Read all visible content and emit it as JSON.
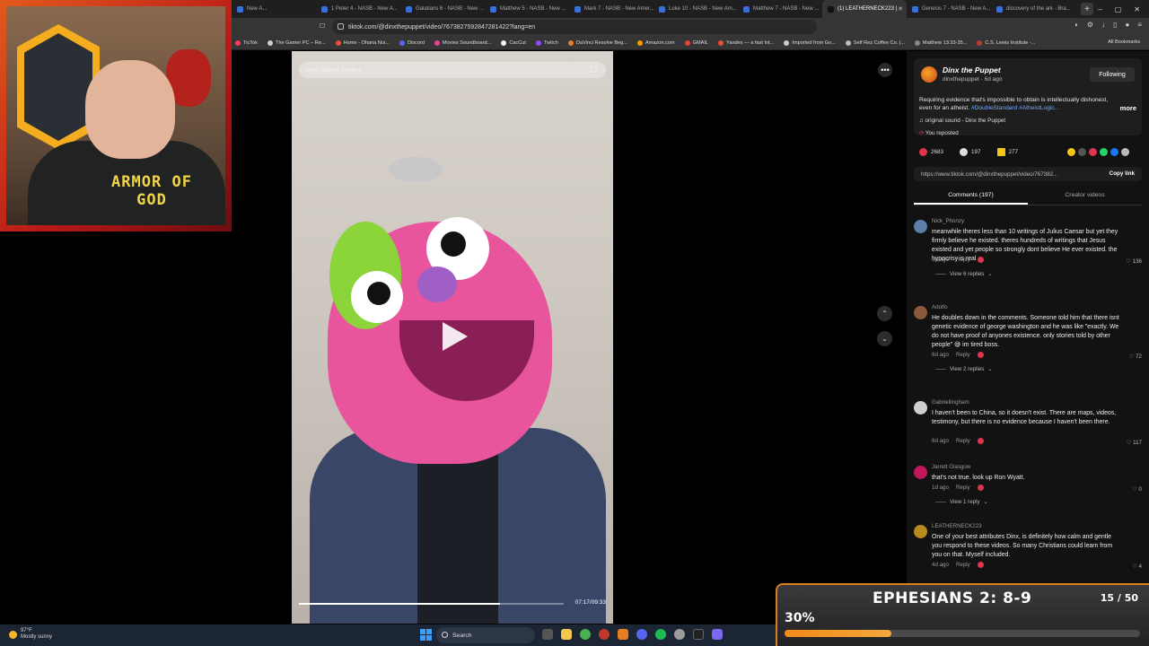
{
  "browser": {
    "tabs": [
      {
        "label": "New A..."
      },
      {
        "label": "1 Peter 4 - NASB - New A..."
      },
      {
        "label": "Galatians 6 - NASB - New ..."
      },
      {
        "label": "Matthew 5 - NASB - New ..."
      },
      {
        "label": "Mark 7 - NASB - New Amer..."
      },
      {
        "label": "Luke 10 - NASB - New Am..."
      },
      {
        "label": "Matthew 7 - NASB - New ..."
      },
      {
        "label": "(1) LEATHERNECK223 |",
        "active": true
      },
      {
        "label": "Genesis 7 - NASB - New A..."
      },
      {
        "label": "discovery of the ark - Bra..."
      }
    ],
    "new_tab": "+",
    "url": "tiktok.com/@dinxthepuppet/video/7673827592847281422?lang=en",
    "bookmarks": [
      "TicTok",
      "The Gamer PC – Re...",
      "Home - Ohana Nui...",
      "Discord",
      "Movies Soundboard...",
      "CacCut",
      "Twitch",
      "DaVinci Resolve Beg...",
      "Amazon.com",
      "GMAIL",
      "Yandex — a fast Int...",
      "Imported from Go...",
      "Self Rez Coffee Co. |...",
      "Matthew 13:33-35...",
      "C.S. Lewis Institute -..."
    ],
    "all_bookmarks": "All Bookmarks"
  },
  "webcam": {
    "shirt_text": "ARMOR OF GOD"
  },
  "video": {
    "search_placeholder": "Find related content",
    "time": "07:17/09:33",
    "progress": 0.76
  },
  "post": {
    "author": "Dinx the Puppet",
    "handle": "dinxthepuppet · 6d ago",
    "follow_label": "Following",
    "description": "Requiring evidence that's impossible to obtain is intellectually dishonest, even for an atheist.",
    "tags": "#DoubleStandard #AtheistLogic...",
    "more": "more",
    "sound": "original sound - Dinx the Puppet",
    "reposted": "You reposted",
    "likes": "2683",
    "comments_count": "197",
    "saves": "277",
    "link": "https://www.tiktok.com/@dinxthepuppet/video/767382...",
    "copy_link": "Copy link",
    "tab_comments": "Comments (197)",
    "tab_creator": "Creator videos"
  },
  "comments": [
    {
      "name": "Nick_Phonzy",
      "text": "meanwhile theres less than 10 writings of Julius Caesar but yet they firmly believe he existed. theres hundreds of writings that Jesus existed and yet people so strongly dont believe He ever existed. the hypocrisy is real",
      "age": "6d ago",
      "reply": "Reply",
      "likes": "136",
      "replies": "View 6 replies",
      "color": "#5b7fa8"
    },
    {
      "name": "Adolfo",
      "text": "He doubles down in the comments. Someone told him that there isnt genetic evidence of george washington and he was like \"exactly. We do not have proof of anyones existence. only stories told by other people\" 😅 im tired boss.",
      "age": "6d ago",
      "reply": "Reply",
      "likes": "72",
      "replies": "View 2 replies",
      "color": "#8a5a3c"
    },
    {
      "name": "Gabriellingham",
      "text": "I haven't been to China, so it doesn't exist. There are maps, videos, testimony, but there is no evidence because I haven't been there.",
      "age": "6d ago",
      "reply": "Reply",
      "likes": "117",
      "replies": "",
      "color": "#cfcfcf"
    },
    {
      "name": "Jarrett Glasgow",
      "text": "that's not true. look up Ron Wyatt.",
      "age": "1d ago",
      "reply": "Reply",
      "likes": "0",
      "replies": "View 1 reply",
      "color": "#c2185b"
    },
    {
      "name": "LEATHERNECK223",
      "text": "One of your best attributes Dinx, is definitely how calm and gentle you respond to these videos. So many Christians could learn from you on that. Myself included.",
      "age": "4d ago",
      "reply": "Reply",
      "likes": "4",
      "replies": "",
      "color": "#b88a1f"
    }
  ],
  "verse_overlay": {
    "title": "EPHESIANS 2: 8-9",
    "count": "15 / 50",
    "percent_label": "30%",
    "progress": 0.3
  },
  "taskbar": {
    "temp": "97°F",
    "weather": "Mostly sunny",
    "search": "Search"
  }
}
